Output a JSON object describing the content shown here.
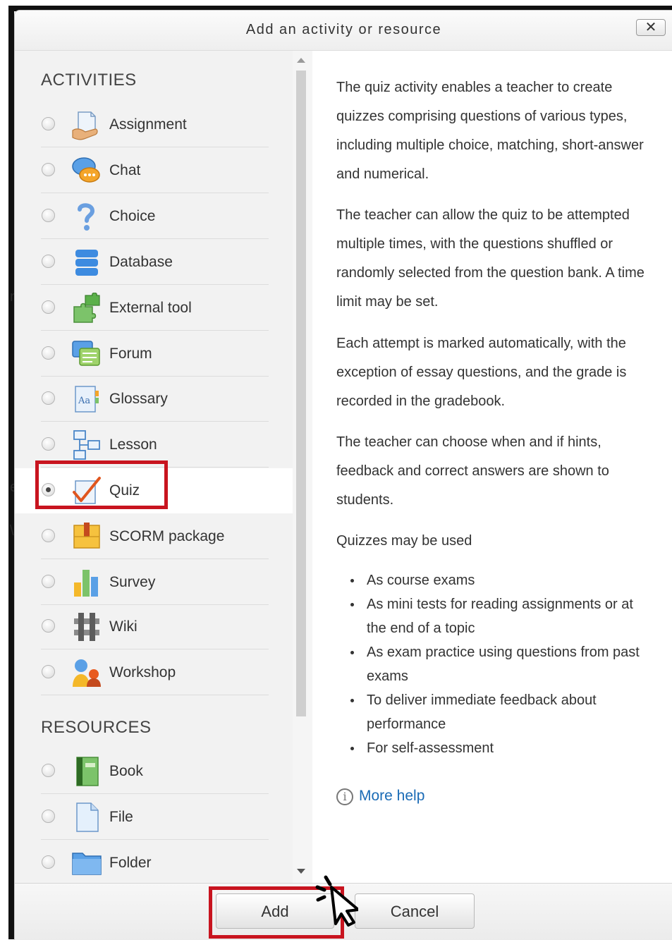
{
  "dialog": {
    "title": "Add an activity or resource",
    "close_label": "✕"
  },
  "background_fragments": [
    "n",
    "e",
    "\\"
  ],
  "activities": {
    "heading": "ACTIVITIES",
    "items": [
      {
        "label": "Assignment",
        "icon": "assignment-icon",
        "selected": false
      },
      {
        "label": "Chat",
        "icon": "chat-icon",
        "selected": false
      },
      {
        "label": "Choice",
        "icon": "choice-icon",
        "selected": false
      },
      {
        "label": "Database",
        "icon": "database-icon",
        "selected": false
      },
      {
        "label": "External tool",
        "icon": "external-tool-icon",
        "selected": false
      },
      {
        "label": "Forum",
        "icon": "forum-icon",
        "selected": false
      },
      {
        "label": "Glossary",
        "icon": "glossary-icon",
        "selected": false
      },
      {
        "label": "Lesson",
        "icon": "lesson-icon",
        "selected": false
      },
      {
        "label": "Quiz",
        "icon": "quiz-icon",
        "selected": true
      },
      {
        "label": "SCORM package",
        "icon": "scorm-package-icon",
        "selected": false
      },
      {
        "label": "Survey",
        "icon": "survey-icon",
        "selected": false
      },
      {
        "label": "Wiki",
        "icon": "wiki-icon",
        "selected": false
      },
      {
        "label": "Workshop",
        "icon": "workshop-icon",
        "selected": false
      }
    ]
  },
  "resources": {
    "heading": "RESOURCES",
    "items": [
      {
        "label": "Book",
        "icon": "book-icon",
        "selected": false
      },
      {
        "label": "File",
        "icon": "file-icon",
        "selected": false
      },
      {
        "label": "Folder",
        "icon": "folder-icon",
        "selected": false
      }
    ]
  },
  "description": {
    "paragraphs": [
      "The quiz activity enables a teacher to create quizzes comprising questions of various types, including multiple choice, matching, short-answer and numerical.",
      "The teacher can allow the quiz to be attempted multiple times, with the questions shuffled or randomly selected from the question bank. A time limit may be set.",
      "Each attempt is marked automatically, with the exception of essay questions, and the grade is recorded in the gradebook.",
      "The teacher can choose when and if hints, feedback and correct answers are shown to students.",
      "Quizzes may be used"
    ],
    "bullets": [
      "As course exams",
      "As mini tests for reading assignments or at the end of a topic",
      "As exam practice using questions from past exams",
      "To deliver immediate feedback about performance",
      "For self-assessment"
    ],
    "help_icon_glyph": "i",
    "help_link": "More help"
  },
  "footer": {
    "add_label": "Add",
    "cancel_label": "Cancel"
  },
  "colors": {
    "highlight": "#c8141f",
    "link": "#1a6bb6",
    "panel_bg": "#f2f2f2"
  }
}
